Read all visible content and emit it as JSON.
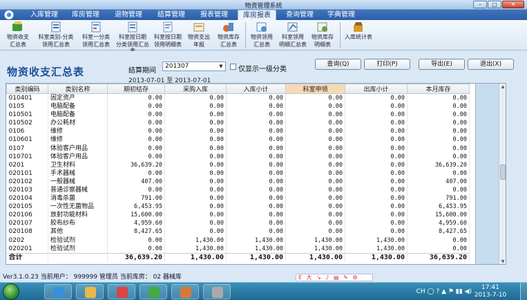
{
  "window": {
    "title": "物资管理系统",
    "minimize": "–",
    "maximize": "□",
    "close": "✕"
  },
  "menu": [
    {
      "label": "入库管理"
    },
    {
      "label": "库房管理"
    },
    {
      "label": "退物管理"
    },
    {
      "label": "结算管理"
    },
    {
      "label": "报表管理"
    },
    {
      "label": "库房报表",
      "active": true
    },
    {
      "label": "查询管理"
    },
    {
      "label": "字典管理"
    }
  ],
  "toolbar": [
    {
      "label1": "物资收支",
      "label2": "汇总表",
      "icon": "summary-icon",
      "color": "#3f9a3a"
    },
    {
      "label1": "科室类别-分类",
      "label2": "领用汇总表",
      "icon": "dept-category-icon",
      "color": "#5a7fb6"
    },
    {
      "label1": "科室一分类",
      "label2": "领用汇总表",
      "icon": "dept-class-icon",
      "color": "#4f8fc8"
    },
    {
      "label1": "科室按日期",
      "label2": "分类领用汇总表",
      "icon": "date-class-icon",
      "color": "#6a8fc0"
    },
    {
      "label1": "科室按日期",
      "label2": "领用明细表",
      "icon": "date-detail-icon",
      "color": "#7a9ac8"
    },
    {
      "label1": "物资支出",
      "label2": "年报",
      "icon": "annual-report-icon",
      "color": "#c8a23a"
    },
    {
      "label1": "物资库存",
      "label2": "汇总表",
      "icon": "stock-summary-icon",
      "color": "#d26b3a"
    },
    {
      "label1": "物资领用",
      "label2": "汇总表",
      "icon": "use-summary-icon",
      "color": "#4f8fc8"
    },
    {
      "label1": "科室领用",
      "label2": "明细汇总表",
      "icon": "dept-use-icon",
      "color": "#5a7fb6"
    },
    {
      "label1": "物资库存",
      "label2": "明细表",
      "icon": "stock-detail-icon",
      "color": "#6b9b4a"
    },
    {
      "label1": "入库统计表",
      "label2": "",
      "icon": "inbound-stats-icon",
      "color": "#d79a2a"
    }
  ],
  "header": {
    "title": "物资收支汇总表",
    "period_label": "结算期间",
    "period_value": "201307",
    "checkbox_label": "仅显示一级分类",
    "range_from": "2013-07-01",
    "range_sep": "至",
    "range_to": "2013-07-01"
  },
  "buttons": {
    "query": "查询(Q)",
    "print": "打印(P)",
    "export": "导出(E)",
    "exit": "退出(X)"
  },
  "table": {
    "columns": [
      "类别编码",
      "类别名称",
      "期初结存",
      "采购入库",
      "入库小计",
      "科室申领",
      "出库小计",
      "本月库存"
    ],
    "rows": [
      [
        "010401",
        "固定资产",
        "0.00",
        "0.00",
        "0.00",
        "0.00",
        "0.00",
        "0.00"
      ],
      [
        "0105",
        "电脑配备",
        "0.00",
        "0.00",
        "0.00",
        "0.00",
        "0.00",
        "0.00"
      ],
      [
        "010501",
        "电脑配备",
        "0.00",
        "0.00",
        "0.00",
        "0.00",
        "0.00",
        "0.00"
      ],
      [
        "010502",
        "办公耗材",
        "0.00",
        "0.00",
        "0.00",
        "0.00",
        "0.00",
        "0.00"
      ],
      [
        "0106",
        "维修",
        "0.00",
        "0.00",
        "0.00",
        "0.00",
        "0.00",
        "0.00"
      ],
      [
        "010601",
        "维修",
        "0.00",
        "0.00",
        "0.00",
        "0.00",
        "0.00",
        "0.00"
      ],
      [
        "0107",
        "体验客户用品",
        "0.00",
        "0.00",
        "0.00",
        "0.00",
        "0.00",
        "0.00"
      ],
      [
        "010701",
        "体验客户用品",
        "0.00",
        "0.00",
        "0.00",
        "0.00",
        "0.00",
        "0.00"
      ],
      [
        "0201",
        "卫生材料",
        "36,639.20",
        "0.00",
        "0.00",
        "0.00",
        "0.00",
        "36,639.20"
      ],
      [
        "020101",
        "手术器械",
        "0.00",
        "0.00",
        "0.00",
        "0.00",
        "0.00",
        "0.00"
      ],
      [
        "020102",
        "一般器械",
        "407.00",
        "0.00",
        "0.00",
        "0.00",
        "0.00",
        "407.00"
      ],
      [
        "020103",
        "普通诊察器械",
        "0.00",
        "0.00",
        "0.00",
        "0.00",
        "0.00",
        "0.00"
      ],
      [
        "020104",
        "消毒杀菌",
        "791.00",
        "0.00",
        "0.00",
        "0.00",
        "0.00",
        "791.00"
      ],
      [
        "020105",
        "一次性无菌物品",
        "6,453.95",
        "0.00",
        "0.00",
        "0.00",
        "0.00",
        "6,453.95"
      ],
      [
        "020106",
        "放射功能材料",
        "15,600.00",
        "0.00",
        "0.00",
        "0.00",
        "0.00",
        "15,600.00"
      ],
      [
        "020107",
        "胶布纱布",
        "4,959.60",
        "0.00",
        "0.00",
        "0.00",
        "0.00",
        "4,959.60"
      ],
      [
        "020108",
        "其他",
        "8,427.65",
        "0.00",
        "0.00",
        "0.00",
        "0.00",
        "8,427.65"
      ],
      [
        "0202",
        "检验试剂",
        "0.00",
        "1,430.00",
        "1,430.00",
        "1,430.00",
        "1,430.00",
        "0.00"
      ],
      [
        "020201",
        "检验试剂",
        "0.00",
        "1,430.00",
        "1,430.00",
        "1,430.00",
        "1,430.00",
        "0.00"
      ]
    ],
    "total": [
      "合计",
      "",
      "36,639.20",
      "1,430.00",
      "1,430.00",
      "1,430.00",
      "1,430.00",
      "36,639.20"
    ]
  },
  "status": {
    "text": "Ver3.1.0.23  当前用户：  999999 管理员  当前库房：  02 器械库",
    "ime": "E 大 ↘ ♪ ▤ ✎ ⚙"
  },
  "taskbar": {
    "apps": [
      {
        "name": "explorer-ie",
        "color": "#3b8fd6"
      },
      {
        "name": "folder",
        "color": "#e6b94a"
      },
      {
        "name": "chrome",
        "color": "#d44"
      },
      {
        "name": "app-green",
        "color": "#4a4"
      },
      {
        "name": "paint",
        "color": "#d47a3a"
      },
      {
        "name": "notepad",
        "color": "#aaa"
      }
    ],
    "tray": "CH ◯ ? ▲ ⚑ ▮▮ ◀)",
    "time": "17:41",
    "date": "2013-7-10"
  }
}
